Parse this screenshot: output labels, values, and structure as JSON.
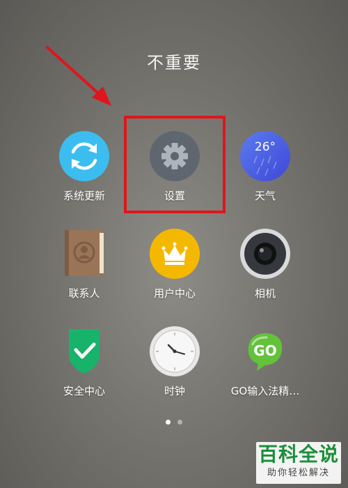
{
  "folder": {
    "title": "不重要"
  },
  "apps": [
    {
      "label": "系统更新",
      "icon": "sync-icon"
    },
    {
      "label": "设置",
      "icon": "gear-icon"
    },
    {
      "label": "天气",
      "icon": "weather-icon",
      "temperature": "26°"
    },
    {
      "label": "联系人",
      "icon": "contacts-icon"
    },
    {
      "label": "用户中心",
      "icon": "crown-icon"
    },
    {
      "label": "相机",
      "icon": "camera-icon"
    },
    {
      "label": "安全中心",
      "icon": "shield-icon"
    },
    {
      "label": "时钟",
      "icon": "clock-icon"
    },
    {
      "label": "GO输入法精…",
      "icon": "go-keyboard-icon",
      "logo_text": "GO"
    }
  ],
  "pager": {
    "pages": 2,
    "current": 1
  },
  "watermark": {
    "main": "百科全说",
    "sub": "助你轻松解决"
  },
  "colors": {
    "highlight": "#e0151b",
    "sync": "#3cbdf0",
    "settings": "#5f6670",
    "weather": "#4f63e8",
    "contacts": "#9a7457",
    "user_center": "#f5b800",
    "security": "#18b36a",
    "go_keyboard": "#63c23a"
  }
}
